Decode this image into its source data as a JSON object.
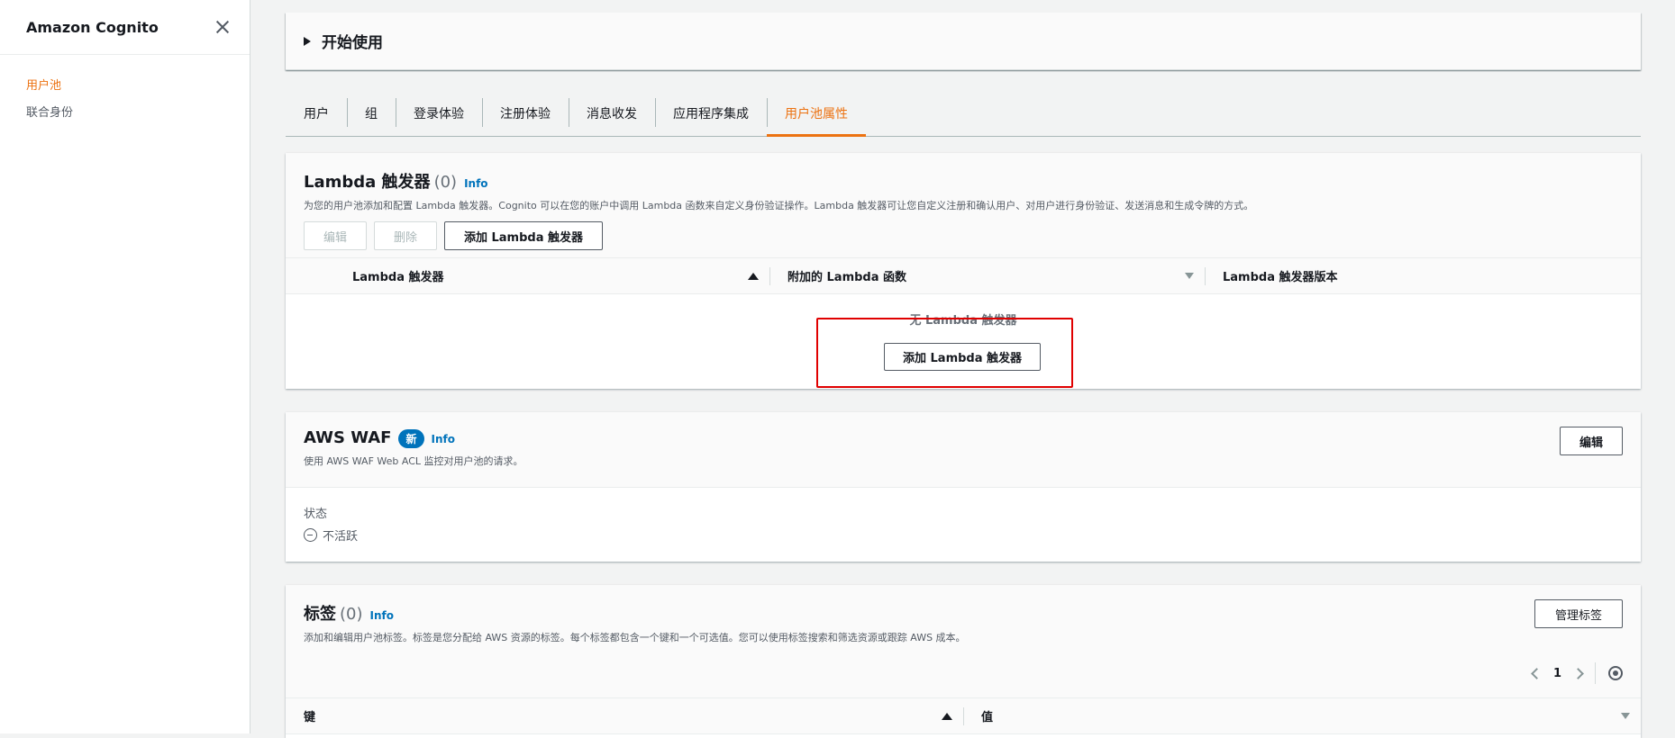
{
  "sidebar": {
    "title": "Amazon Cognito",
    "items": [
      {
        "label": "用户池"
      },
      {
        "label": "联合身份"
      }
    ]
  },
  "getting_started": {
    "title": "开始使用"
  },
  "tabs": [
    {
      "label": "用户"
    },
    {
      "label": "组"
    },
    {
      "label": "登录体验"
    },
    {
      "label": "注册体验"
    },
    {
      "label": "消息收发"
    },
    {
      "label": "应用程序集成"
    },
    {
      "label": "用户池属性"
    }
  ],
  "lambda": {
    "title": "Lambda 触发器",
    "count": "(0)",
    "info": "Info",
    "description": "为您的用户池添加和配置 Lambda 触发器。Cognito 可以在您的账户中调用 Lambda 函数来自定义身份验证操作。Lambda 触发器可让您自定义注册和确认用户、对用户进行身份验证、发送消息和生成令牌的方式。",
    "edit_label": "编辑",
    "delete_label": "删除",
    "add_label": "添加 Lambda 触发器",
    "columns": [
      "Lambda 触发器",
      "附加的 Lambda 函数",
      "Lambda 触发器版本"
    ],
    "empty_text": "无 Lambda 触发器",
    "empty_add_label": "添加 Lambda 触发器"
  },
  "waf": {
    "title": "AWS WAF",
    "badge": "新",
    "info": "Info",
    "description": "使用 AWS WAF Web ACL 监控对用户池的请求。",
    "edit_label": "编辑",
    "status_label": "状态",
    "status_value": "不活跃"
  },
  "tags": {
    "title": "标签",
    "count": "(0)",
    "info": "Info",
    "description": "添加和编辑用户池标签。标签是您分配给 AWS 资源的标签。每个标签都包含一个键和一个可选值。您可以使用标签搜索和筛选资源或跟踪 AWS 成本。",
    "manage_label": "管理标签",
    "page": "1",
    "columns": [
      "键",
      "值"
    ]
  }
}
